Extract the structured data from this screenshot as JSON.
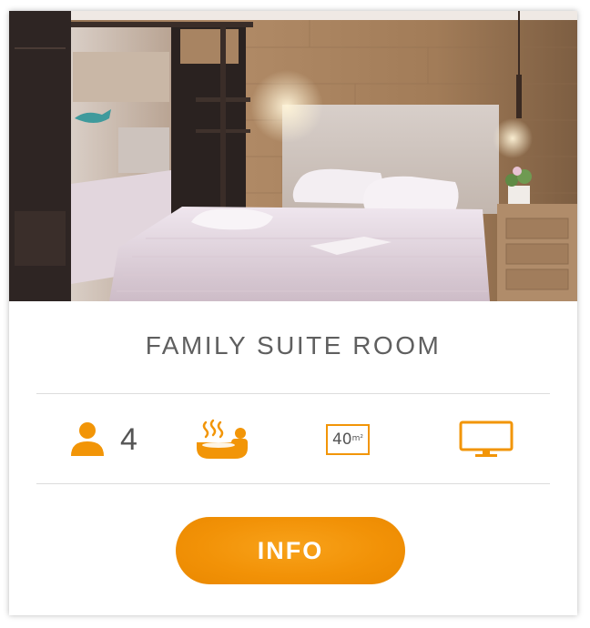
{
  "room": {
    "title": "FAMILY SUITE ROOM"
  },
  "amenities": {
    "guests": {
      "icon": "person-icon",
      "count": "4"
    },
    "spa": {
      "icon": "hot-tub-icon"
    },
    "area": {
      "icon": "area-badge",
      "value": "40",
      "unit": "m²"
    },
    "tv": {
      "icon": "tv-icon"
    }
  },
  "actions": {
    "info_label": "INFO"
  },
  "colors": {
    "accent": "#f29507",
    "text": "#5f5f5f",
    "divider": "#dcdcdc"
  }
}
